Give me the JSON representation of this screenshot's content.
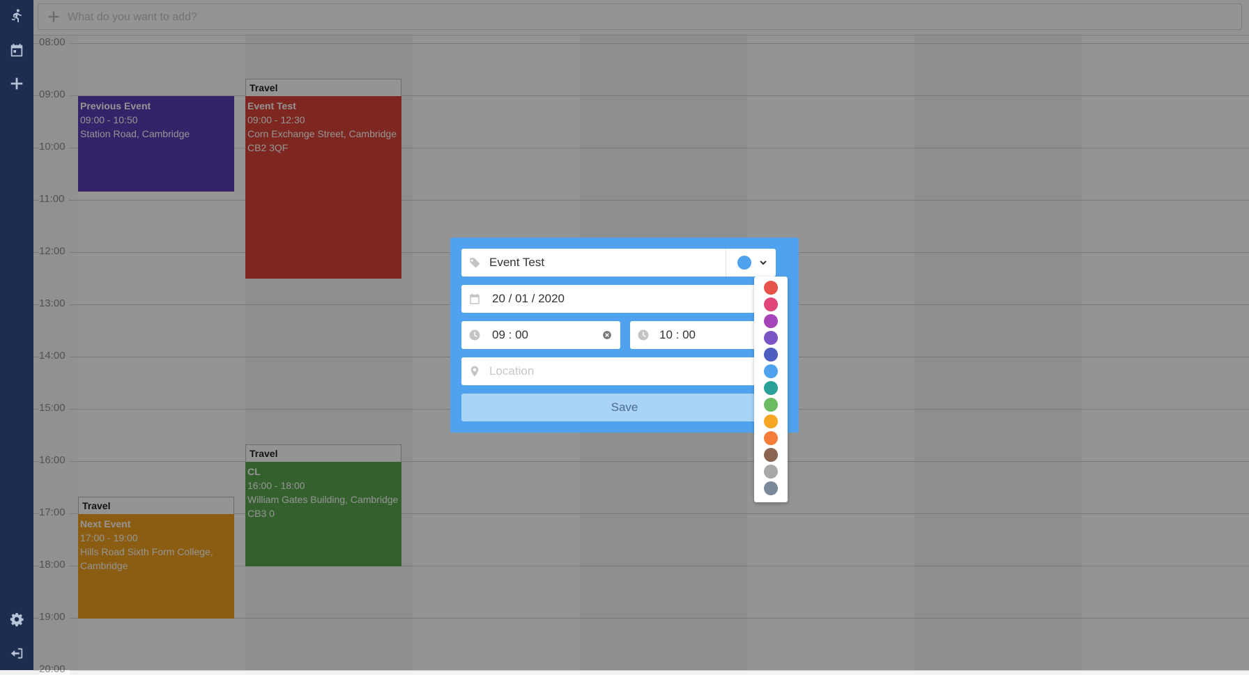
{
  "topbar": {
    "placeholder": "What do you want to add?"
  },
  "sidebar": {
    "items": [
      {
        "icon": "running-icon"
      },
      {
        "icon": "calendar-icon"
      },
      {
        "icon": "plus-icon"
      },
      {
        "icon": "gear-icon"
      },
      {
        "icon": "sign-out-icon"
      }
    ]
  },
  "calendar": {
    "hours": [
      "08:00",
      "09:00",
      "10:00",
      "11:00",
      "12:00",
      "13:00",
      "14:00",
      "15:00",
      "16:00",
      "17:00",
      "18:00",
      "19:00",
      "20:00"
    ],
    "travel_label": "Travel",
    "events": [
      {
        "title": "Previous Event",
        "time": "09:00 - 10:50",
        "location": "Station Road, Cambridge",
        "color": "#5a3db5"
      },
      {
        "title": "Event Test",
        "time": "09:00 - 12:30",
        "location": "Corn Exchange Street, Cambridge CB2 3QF",
        "color": "#d9443a"
      },
      {
        "title": "CL",
        "time": "16:00 - 18:00",
        "location": "William Gates Building, Cambridge CB3 0",
        "color": "#5aa64f"
      },
      {
        "title": "Next Event",
        "time": "17:00 - 19:00",
        "location": "Hills Road Sixth Form College, Cambridge",
        "color": "#f0a020"
      }
    ]
  },
  "modal": {
    "title_value": "Event Test",
    "date_value": "20 / 01 / 2020",
    "start_time": "09 : 00",
    "end_time": "10 : 00",
    "location_placeholder": "Location",
    "save_label": "Save",
    "selected_color": "#4fa3ee"
  },
  "palette": {
    "colors": [
      "#e5534b",
      "#e0457b",
      "#a444b8",
      "#7c55c4",
      "#4f5fc0",
      "#4fa3ee",
      "#2aa198",
      "#6bbb63",
      "#f6a623",
      "#f47d3a",
      "#8a6552",
      "#a8a8a8",
      "#7a8a9a"
    ]
  }
}
